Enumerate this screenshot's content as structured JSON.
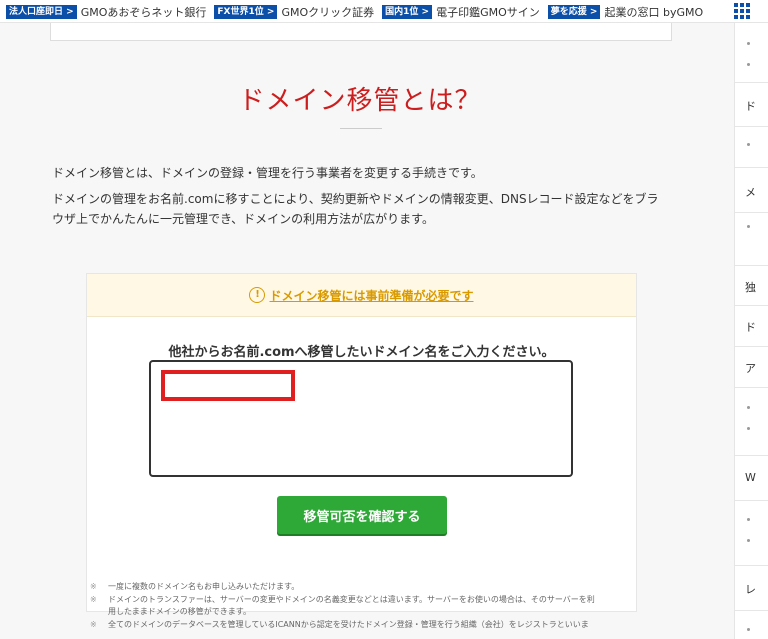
{
  "topbar": {
    "items": [
      {
        "badge": "法人口座即日",
        "label": "GMOあおぞらネット銀行"
      },
      {
        "badge": "FX世界1位",
        "label": "GMOクリック証券"
      },
      {
        "badge": "国内1位",
        "label": "電子印鑑GMOサイン"
      },
      {
        "badge": "夢を応援",
        "label": "起業の窓口 byGMO"
      }
    ],
    "badge_arrow": ">",
    "apps_icon": "grid-icon"
  },
  "main": {
    "title": "ドメイン移管とは？",
    "desc1": "ドメイン移管とは、ドメインの登録・管理を行う事業者を変更する手続きです。",
    "desc2": "ドメインの管理をお名前.comに移すことにより、契約更新やドメインの情報変更、DNSレコード設定などをブラ",
    "desc3": "ウザ上でかんたんに一元管理でき、ドメインの利用方法が広がります。",
    "warning": "ドメイン移管には事前準備が必要です",
    "prompt": "他社からお名前.comへ移管したいドメイン名をご入力ください。",
    "input_value": "",
    "button": "移管可否を確認する",
    "note_mark": "※",
    "note1": "一度に複数のドメイン名もお申し込みいただけます。",
    "note2a": "ドメインのトランスファーは、サーバーの変更やドメインの名義変更などとは違います。サーバーをお使いの場合は、そのサーバーを利",
    "note2b": "用したままドメインの移管ができます。",
    "note3": "全てのドメインのデータベースを管理しているICANNから認定を受けたドメイン登録・管理を行う組織（会社）をレジストラといいま"
  },
  "sidebar": {
    "h1": "ド",
    "h2": "メ",
    "h3": "独",
    "h4": "ド",
    "h5": "ア",
    "h6": "W",
    "h7": "レ"
  }
}
